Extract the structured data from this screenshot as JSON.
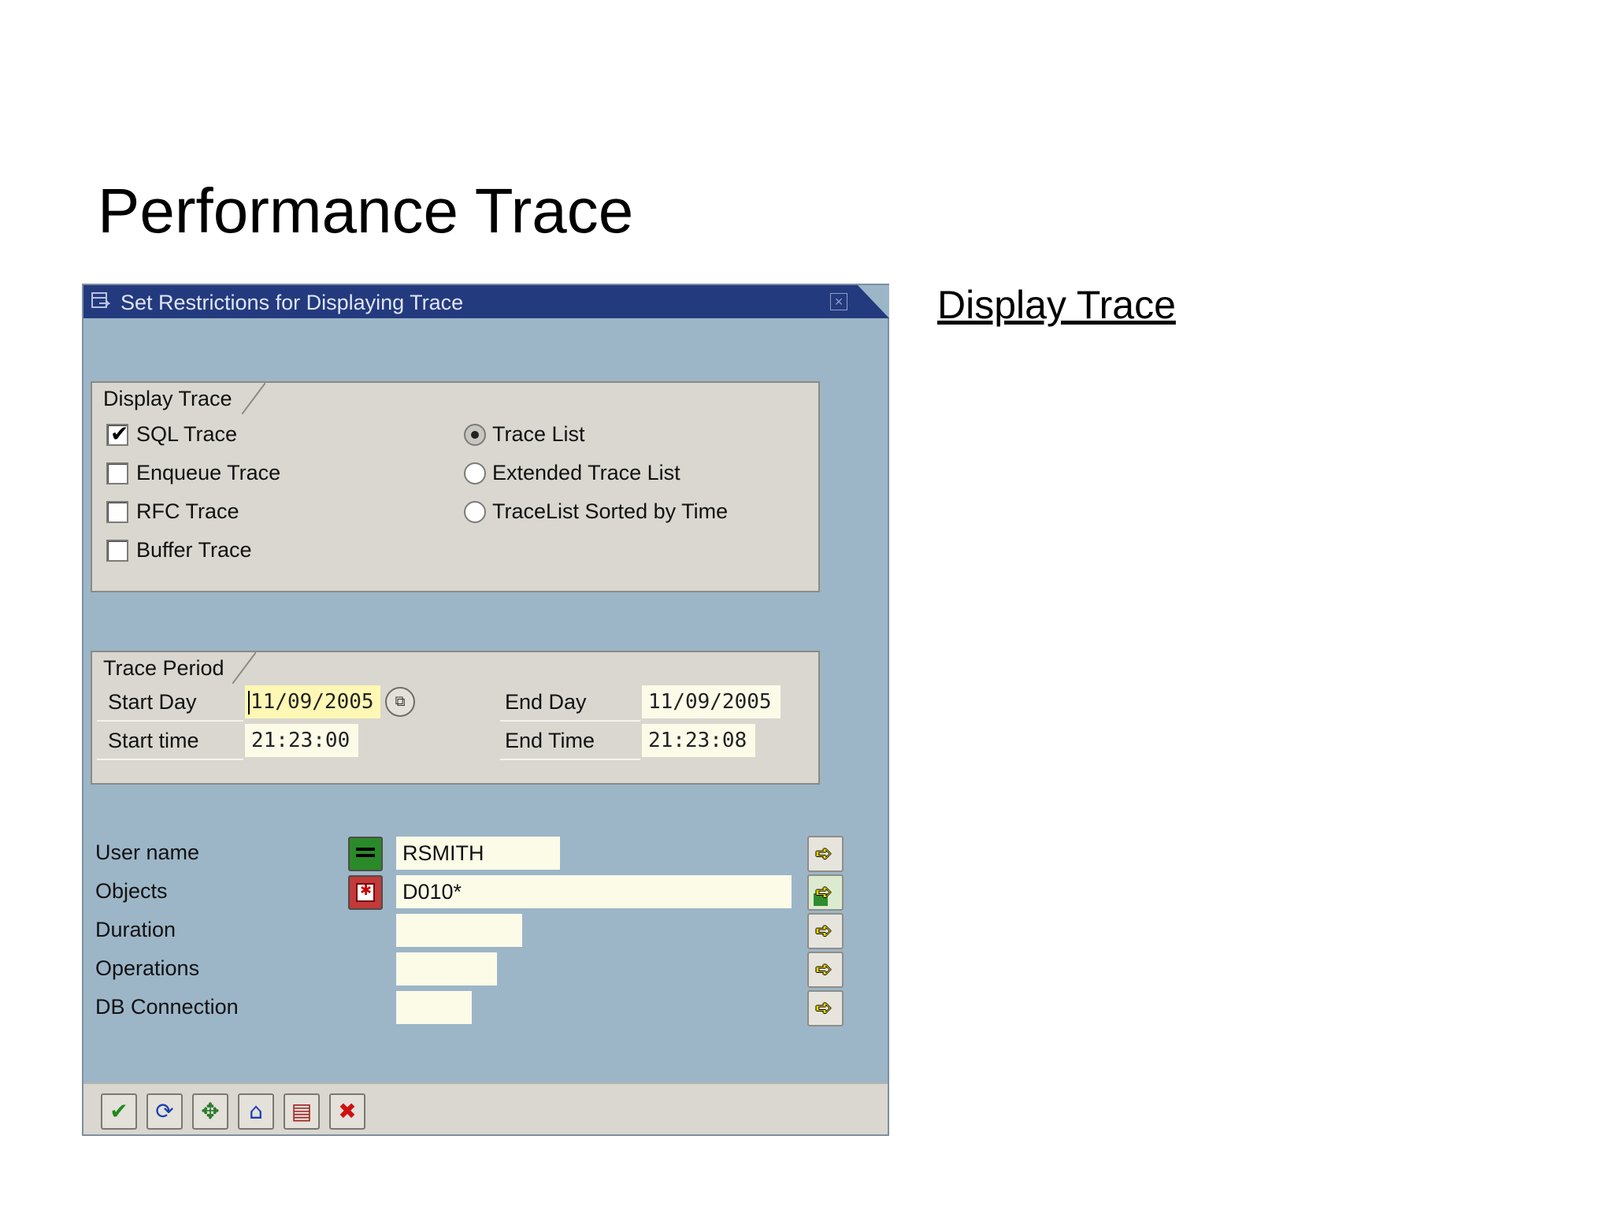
{
  "slide": {
    "title": "Performance Trace",
    "side_link": "Display Trace"
  },
  "dialog": {
    "title": "Set Restrictions for Displaying Trace",
    "close_glyph": "×",
    "display_trace_group": {
      "label": "Display Trace",
      "checkboxes": [
        {
          "label": "SQL Trace",
          "checked": true
        },
        {
          "label": "Enqueue Trace",
          "checked": false
        },
        {
          "label": "RFC Trace",
          "checked": false
        },
        {
          "label": "Buffer Trace",
          "checked": false
        }
      ],
      "radios": [
        {
          "label": "Trace List",
          "selected": true
        },
        {
          "label": "Extended Trace List",
          "selected": false
        },
        {
          "label": "TraceList Sorted by Time",
          "selected": false
        }
      ]
    },
    "trace_period_group": {
      "label": "Trace Period",
      "start_day_label": "Start Day",
      "start_day_value": "11/09/2005",
      "start_time_label": "Start time",
      "start_time_value": "21:23:00",
      "end_day_label": "End Day",
      "end_day_value": "11/09/2005",
      "end_time_label": "End Time",
      "end_time_value": "21:23:08"
    },
    "selections": [
      {
        "label": "User name",
        "value": "RSMITH",
        "option_icon": "equals-option-icon"
      },
      {
        "label": "Objects",
        "value": "D010*",
        "option_icon": "pattern-option-icon"
      },
      {
        "label": "Duration",
        "value": ""
      },
      {
        "label": "Operations",
        "value": ""
      },
      {
        "label": "DB Connection",
        "value": ""
      }
    ],
    "toolbar": [
      {
        "name": "execute-button",
        "icon": "check-icon",
        "glyph": "✔",
        "color": "#1f8a1f"
      },
      {
        "name": "refresh-button",
        "icon": "refresh-icon",
        "glyph": "⟳",
        "color": "#1a3fb0"
      },
      {
        "name": "navigate-button",
        "icon": "arrows-icon",
        "glyph": "✥",
        "color": "#2a7a2a"
      },
      {
        "name": "load-variant-button",
        "icon": "variant-icon",
        "glyph": "⌂",
        "color": "#1a3fb0"
      },
      {
        "name": "save-variant-button",
        "icon": "save-icon",
        "glyph": "▤",
        "color": "#a02020"
      },
      {
        "name": "cancel-button",
        "icon": "cancel-icon",
        "glyph": "✖",
        "color": "#d01010"
      }
    ]
  },
  "colors": {
    "titlebar": "#243a7e",
    "dialog_bg": "#9cb6c8",
    "group_bg": "#d9d7cf",
    "input_bg": "#fcfbe8",
    "active_input_bg": "#fff8b4"
  }
}
